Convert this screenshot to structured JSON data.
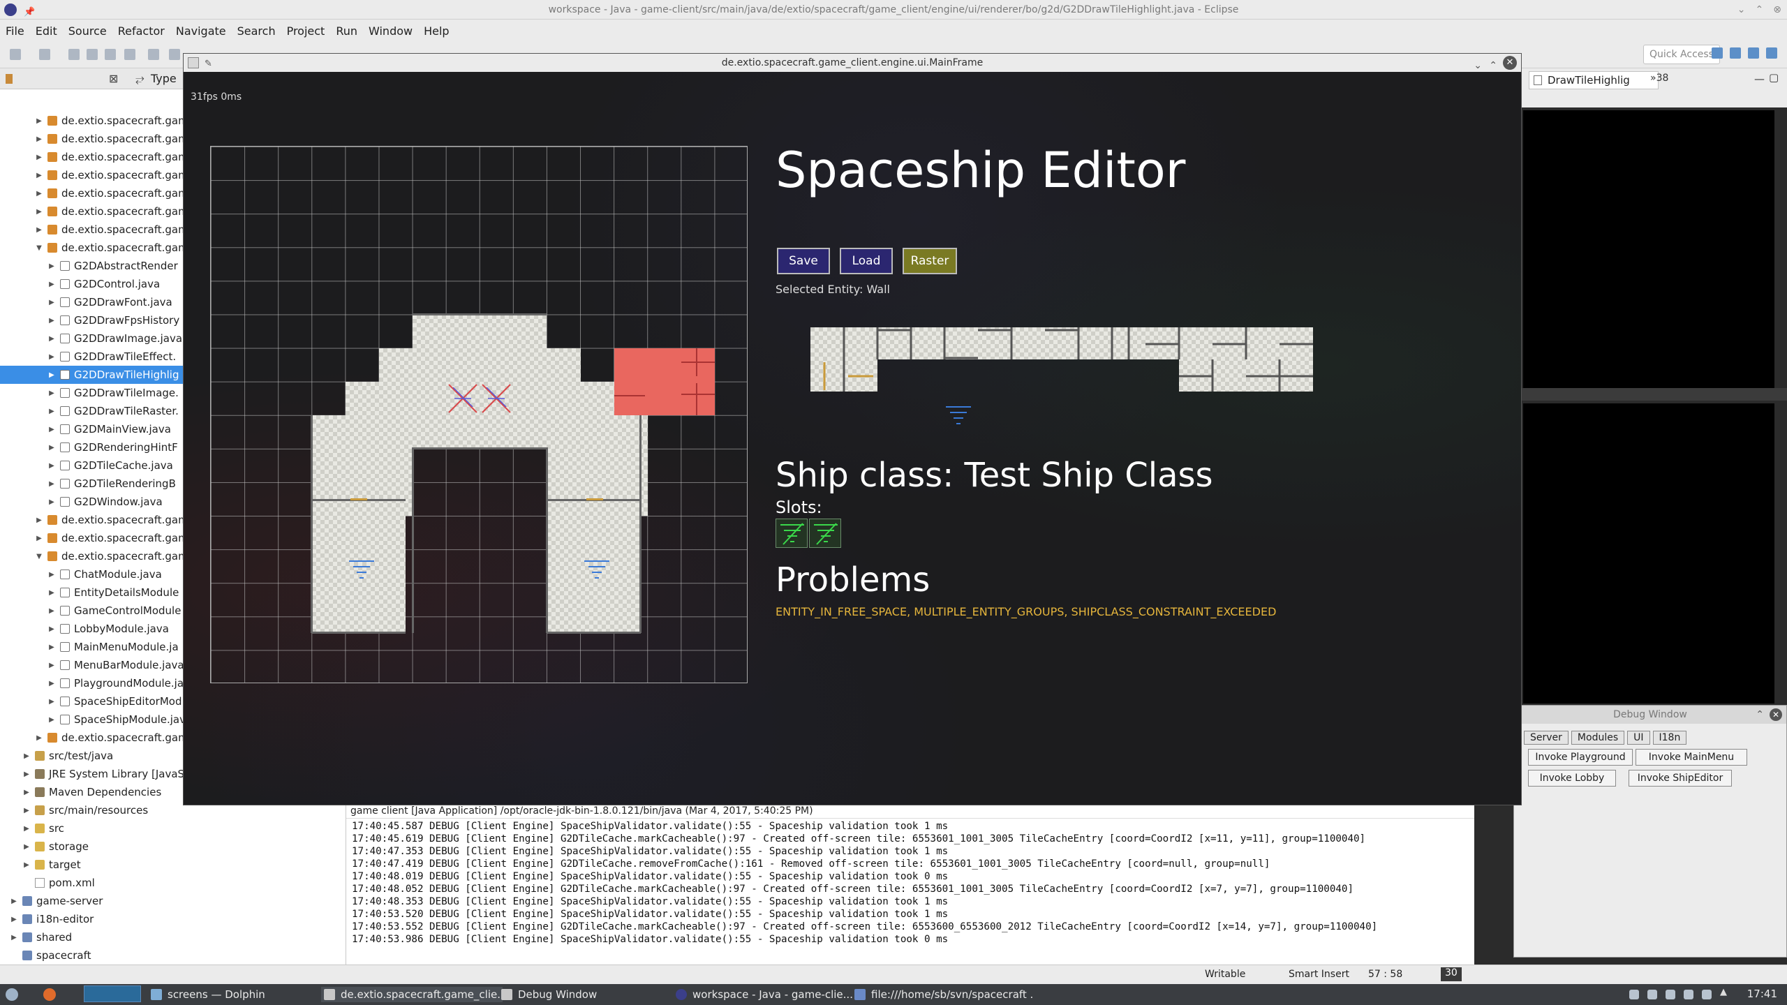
{
  "window": {
    "title": "workspace - Java - game-client/src/main/java/de/extio/spacecraft/game_client/engine/ui/renderer/bo/g2d/G2DDrawTileHighlight.java - Eclipse"
  },
  "menu": [
    "File",
    "Edit",
    "Source",
    "Refactor",
    "Navigate",
    "Search",
    "Project",
    "Run",
    "Window",
    "Help"
  ],
  "quick_access": "Quick Access",
  "package_explorer": {
    "tab_type": "Type",
    "tree": [
      {
        "label": "de.extio.spacecraft.gam",
        "depth": 3,
        "icon": "package-icon",
        "arrow": "▶"
      },
      {
        "label": "de.extio.spacecraft.gam",
        "depth": 3,
        "icon": "package-icon",
        "arrow": "▶"
      },
      {
        "label": "de.extio.spacecraft.gam",
        "depth": 3,
        "icon": "package-icon",
        "arrow": "▶"
      },
      {
        "label": "de.extio.spacecraft.gam",
        "depth": 3,
        "icon": "package-icon",
        "arrow": "▶"
      },
      {
        "label": "de.extio.spacecraft.gam",
        "depth": 3,
        "icon": "package-icon",
        "arrow": "▶"
      },
      {
        "label": "de.extio.spacecraft.gam",
        "depth": 3,
        "icon": "package-icon",
        "arrow": "▶"
      },
      {
        "label": "de.extio.spacecraft.gam",
        "depth": 3,
        "icon": "package-icon",
        "arrow": "▶"
      },
      {
        "label": "de.extio.spacecraft.gam",
        "depth": 3,
        "icon": "package-icon",
        "arrow": "▼"
      },
      {
        "label": "G2DAbstractRender",
        "depth": 4,
        "icon": "java-file-icon",
        "arrow": "▶"
      },
      {
        "label": "G2DControl.java",
        "depth": 4,
        "icon": "java-file-icon",
        "arrow": "▶"
      },
      {
        "label": "G2DDrawFont.java",
        "depth": 4,
        "icon": "java-file-icon",
        "arrow": "▶"
      },
      {
        "label": "G2DDrawFpsHistory",
        "depth": 4,
        "icon": "java-file-icon",
        "arrow": "▶"
      },
      {
        "label": "G2DDrawImage.java",
        "depth": 4,
        "icon": "java-file-icon",
        "arrow": "▶"
      },
      {
        "label": "G2DDrawTileEffect.",
        "depth": 4,
        "icon": "java-file-icon",
        "arrow": "▶"
      },
      {
        "label": "G2DDrawTileHighlig",
        "depth": 4,
        "icon": "java-file-icon",
        "arrow": "▶",
        "selected": true
      },
      {
        "label": "G2DDrawTileImage.",
        "depth": 4,
        "icon": "java-file-icon",
        "arrow": "▶"
      },
      {
        "label": "G2DDrawTileRaster.",
        "depth": 4,
        "icon": "java-file-icon",
        "arrow": "▶"
      },
      {
        "label": "G2DMainView.java",
        "depth": 4,
        "icon": "java-file-icon",
        "arrow": "▶"
      },
      {
        "label": "G2DRenderingHintF",
        "depth": 4,
        "icon": "java-file-icon",
        "arrow": "▶"
      },
      {
        "label": "G2DTileCache.java",
        "depth": 4,
        "icon": "java-file-icon",
        "arrow": "▶"
      },
      {
        "label": "G2DTileRenderingB",
        "depth": 4,
        "icon": "java-file-icon",
        "arrow": "▶"
      },
      {
        "label": "G2DWindow.java",
        "depth": 4,
        "icon": "java-file-icon",
        "arrow": "▶"
      },
      {
        "label": "de.extio.spacecraft.gam",
        "depth": 3,
        "icon": "package-icon",
        "arrow": "▶"
      },
      {
        "label": "de.extio.spacecraft.gam",
        "depth": 3,
        "icon": "package-icon",
        "arrow": "▶"
      },
      {
        "label": "de.extio.spacecraft.gam",
        "depth": 3,
        "icon": "package-icon",
        "arrow": "▼"
      },
      {
        "label": "ChatModule.java",
        "depth": 4,
        "icon": "java-file-icon",
        "arrow": "▶"
      },
      {
        "label": "EntityDetailsModule",
        "depth": 4,
        "icon": "java-file-icon",
        "arrow": "▶"
      },
      {
        "label": "GameControlModule",
        "depth": 4,
        "icon": "java-file-icon",
        "arrow": "▶"
      },
      {
        "label": "LobbyModule.java",
        "depth": 4,
        "icon": "java-file-icon",
        "arrow": "▶"
      },
      {
        "label": "MainMenuModule.ja",
        "depth": 4,
        "icon": "java-file-icon",
        "arrow": "▶"
      },
      {
        "label": "MenuBarModule.java",
        "depth": 4,
        "icon": "java-file-icon",
        "arrow": "▶"
      },
      {
        "label": "PlaygroundModule.ja",
        "depth": 4,
        "icon": "java-file-icon",
        "arrow": "▶"
      },
      {
        "label": "SpaceShipEditorMod",
        "depth": 4,
        "icon": "java-file-icon",
        "arrow": "▶"
      },
      {
        "label": "SpaceShipModule.jav",
        "depth": 4,
        "icon": "java-file-icon",
        "arrow": "▶"
      },
      {
        "label": "de.extio.spacecraft.gam",
        "depth": 3,
        "icon": "package-icon",
        "arrow": "▶"
      },
      {
        "label": "src/test/java",
        "depth": 2,
        "icon": "source-folder-icon",
        "arrow": "▶"
      },
      {
        "label": "JRE System Library [JavaS",
        "depth": 2,
        "icon": "library-icon",
        "arrow": "▶"
      },
      {
        "label": "Maven Dependencies",
        "depth": 2,
        "icon": "library-icon",
        "arrow": "▶"
      },
      {
        "label": "src/main/resources",
        "depth": 2,
        "icon": "source-folder-icon",
        "arrow": "▶"
      },
      {
        "label": "src",
        "depth": 2,
        "icon": "folder-icon",
        "arrow": "▶"
      },
      {
        "label": "storage",
        "depth": 2,
        "icon": "folder-icon",
        "arrow": "▶"
      },
      {
        "label": "target",
        "depth": 2,
        "icon": "folder-icon",
        "arrow": "▶"
      },
      {
        "label": "pom.xml",
        "depth": 2,
        "icon": "xml-file-icon",
        "arrow": ""
      },
      {
        "label": "game-server",
        "depth": 1,
        "icon": "project-icon",
        "arrow": "▶"
      },
      {
        "label": "i18n-editor",
        "depth": 1,
        "icon": "project-icon",
        "arrow": "▶"
      },
      {
        "label": "shared",
        "depth": 1,
        "icon": "project-icon",
        "arrow": "▶"
      },
      {
        "label": "spacecraft",
        "depth": 1,
        "icon": "project-icon",
        "arrow": ""
      }
    ]
  },
  "editor": {
    "tab_label": "DrawTileHighlig",
    "more_tabs": "»38"
  },
  "mainframe": {
    "title": "de.extio.spacecraft.game_client.engine.ui.MainFrame",
    "fps": "31fps 0ms",
    "editor_title": "Spaceship Editor",
    "buttons": {
      "save": "Save",
      "load": "Load",
      "raster": "Raster"
    },
    "selected_entity": "Selected Entity: Wall",
    "ship_class": "Ship class: Test Ship Class",
    "slots_label": "Slots:",
    "problems_title": "Problems",
    "problems_text": "ENTITY_IN_FREE_SPACE, MULTIPLE_ENTITY_GROUPS, SHIPCLASS_CONSTRAINT_EXCEEDED",
    "colors": {
      "button_bg": "#2b2670",
      "raster_bg": "#7a7a23",
      "problem_text": "#e5b53c",
      "highlight_tile": "#e9675f"
    }
  },
  "debug_window": {
    "title": "Debug Window",
    "tabs": [
      "Server",
      "Modules",
      "UI",
      "I18n"
    ],
    "buttons": {
      "invoke_playground": "Invoke Playground",
      "invoke_mainmenu": "Invoke MainMenu",
      "invoke_lobby": "Invoke Lobby",
      "invoke_shipeditor": "Invoke ShipEditor"
    }
  },
  "console": {
    "header": "game client [Java Application] /opt/oracle-jdk-bin-1.8.0.121/bin/java (Mar 4, 2017, 5:40:25 PM)",
    "lines": [
      "17:40:45.587 DEBUG [Client Engine] SpaceShipValidator.validate():55 - Spaceship validation took 1 ms",
      "17:40:45.619 DEBUG [Client Engine] G2DTileCache.markCacheable():97 - Created off-screen tile: 6553601_1001_3005 TileCacheEntry [coord=CoordI2 [x=11, y=11], group=1100040]",
      "17:40:47.353 DEBUG [Client Engine] SpaceShipValidator.validate():55 - Spaceship validation took 1 ms",
      "17:40:47.419 DEBUG [Client Engine] G2DTileCache.removeFromCache():161 - Removed off-screen tile: 6553601_1001_3005 TileCacheEntry [coord=null, group=null]",
      "17:40:48.019 DEBUG [Client Engine] SpaceShipValidator.validate():55 - Spaceship validation took 0 ms",
      "17:40:48.052 DEBUG [Client Engine] G2DTileCache.markCacheable():97 - Created off-screen tile: 6553601_1001_3005 TileCacheEntry [coord=CoordI2 [x=7, y=7], group=1100040]",
      "17:40:48.353 DEBUG [Client Engine] SpaceShipValidator.validate():55 - Spaceship validation took 1 ms",
      "17:40:53.520 DEBUG [Client Engine] SpaceShipValidator.validate():55 - Spaceship validation took 1 ms",
      "17:40:53.552 DEBUG [Client Engine] G2DTileCache.markCacheable():97 - Created off-screen tile: 6553600_6553600_2012 TileCacheEntry [coord=CoordI2 [x=14, y=7], group=1100040]",
      "17:40:53.986 DEBUG [Client Engine] SpaceShipValidator.validate():55 - Spaceship validation took 0 ms"
    ]
  },
  "statusbar": {
    "writable": "Writable",
    "insert_mode": "Smart Insert",
    "position": "57 : 58",
    "count": "30"
  },
  "taskbar": {
    "items": [
      {
        "label": "screens — Dolphin",
        "icon": "dolphin-icon"
      },
      {
        "label": "de.extio.spacecraft.game_clie...",
        "icon": "java-window-icon"
      },
      {
        "label": "Debug Window",
        "icon": "java-window-icon"
      },
      {
        "label": "workspace - Java - game-clie...",
        "icon": "eclipse-icon"
      },
      {
        "label": "file:///home/sb/svn/spacecraft ...",
        "icon": "browser-icon"
      }
    ],
    "clock": "17:41"
  }
}
